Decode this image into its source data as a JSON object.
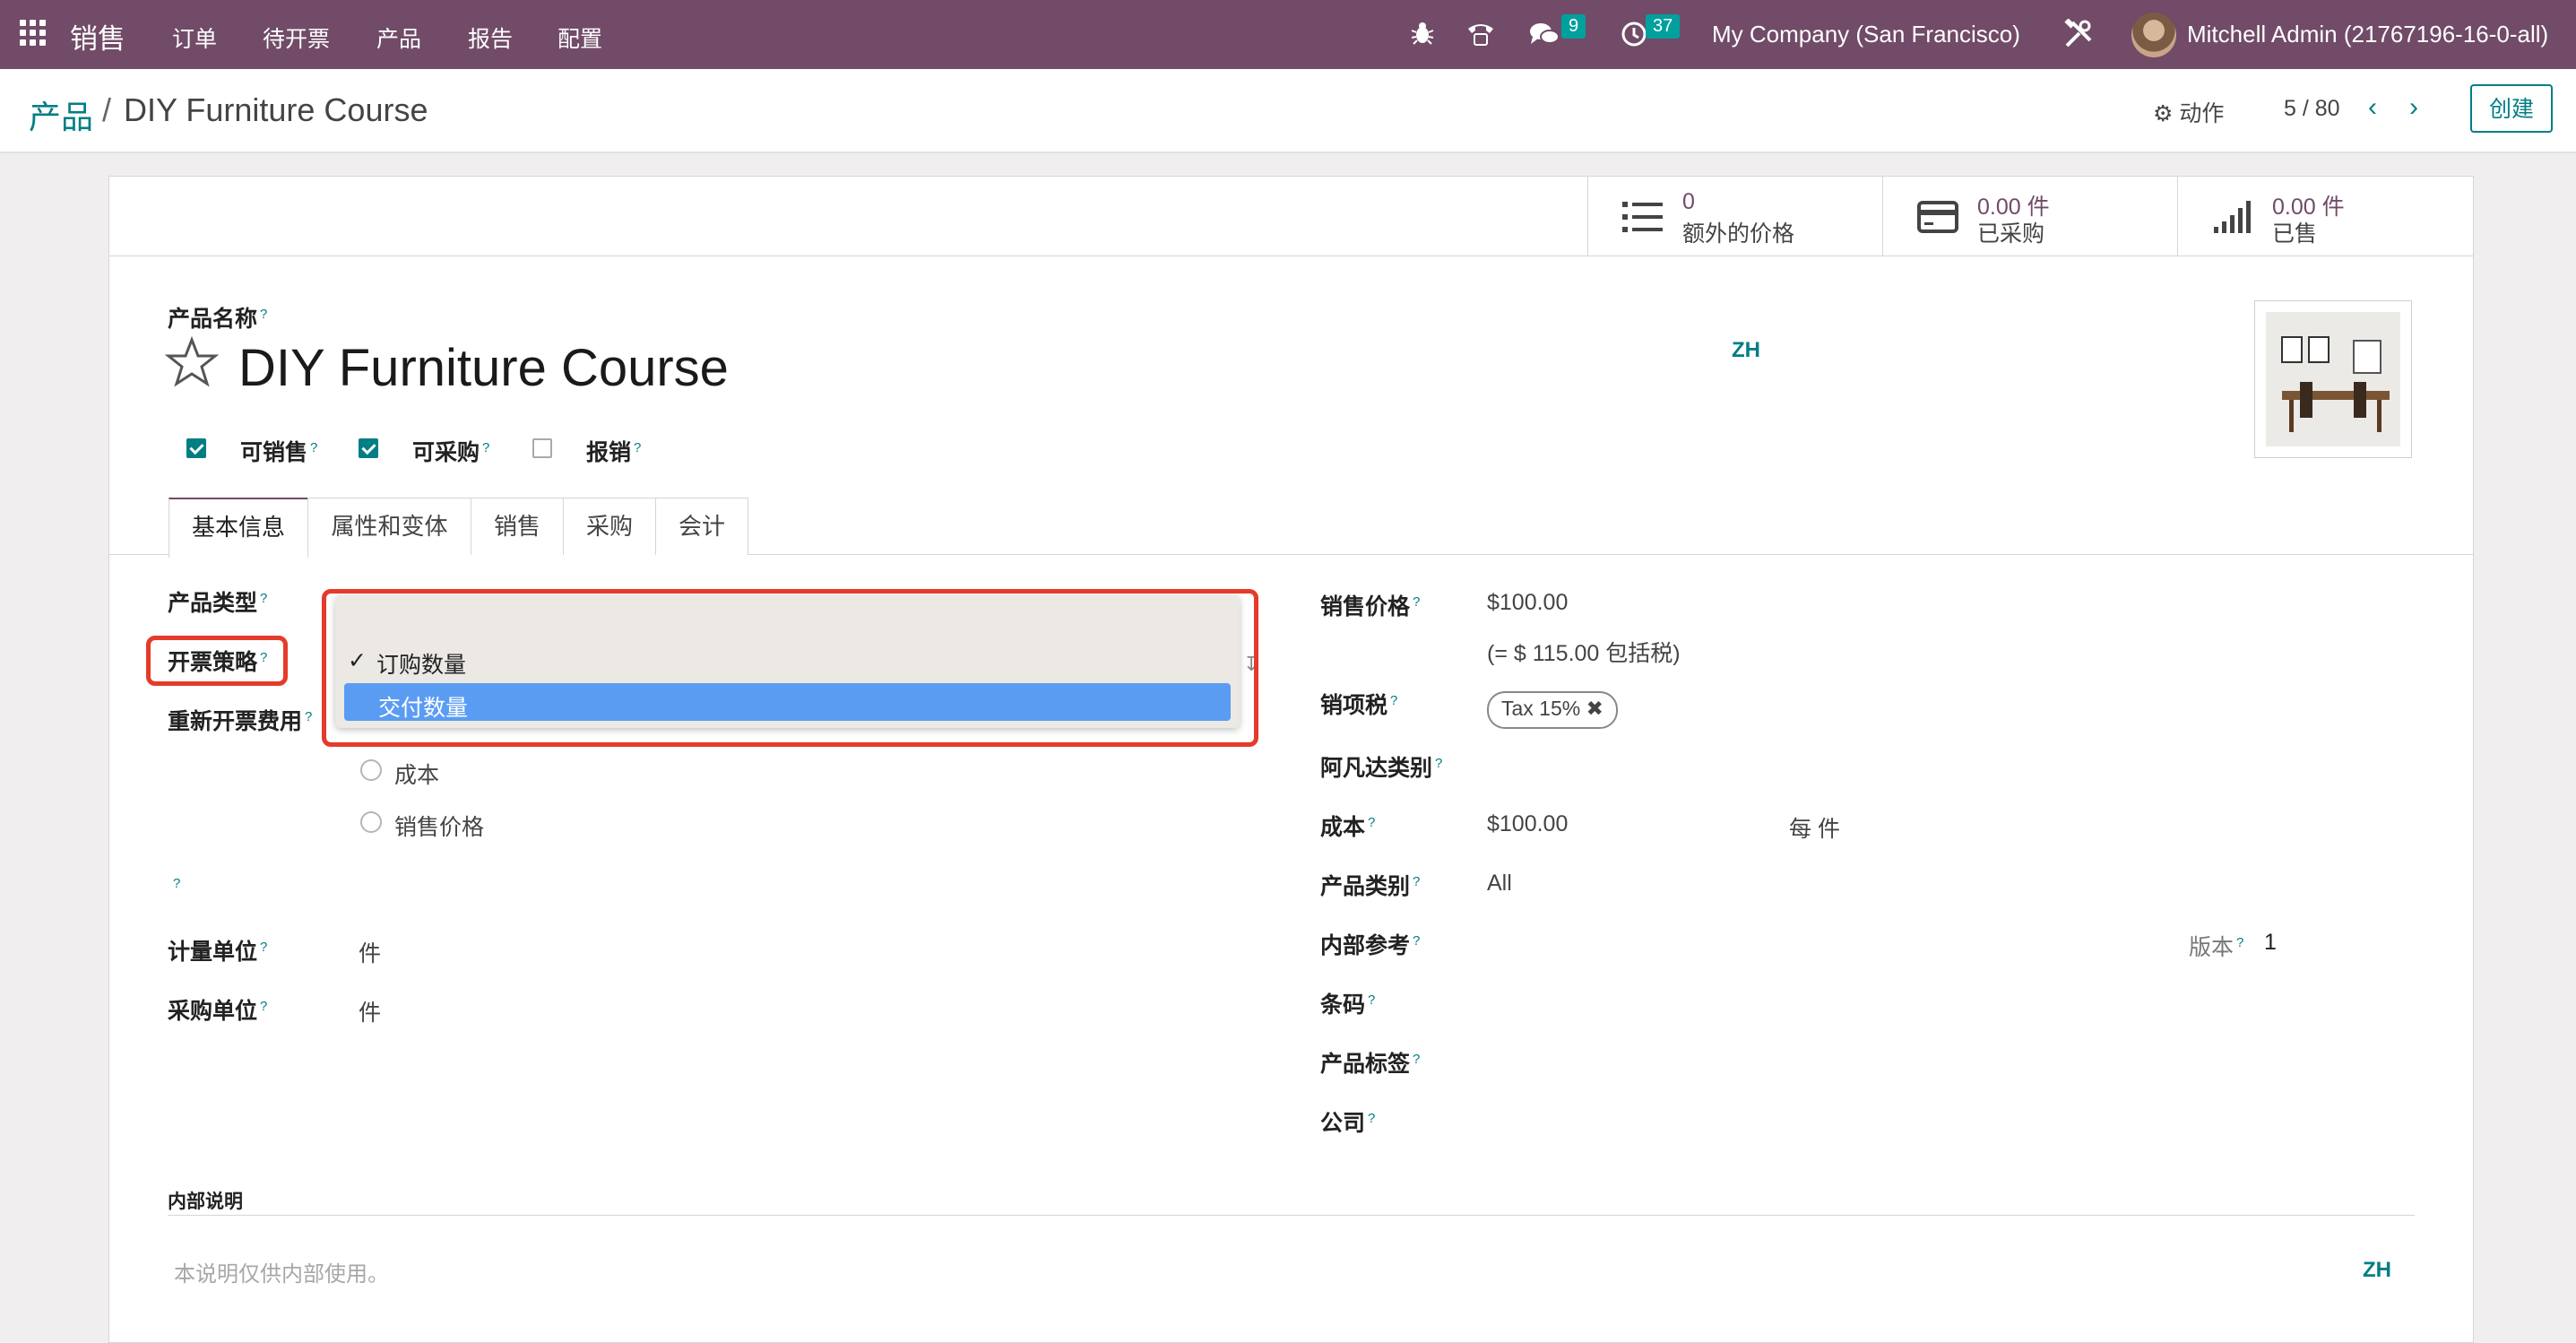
{
  "topbar": {
    "brand": "销售",
    "menu": [
      "订单",
      "待开票",
      "产品",
      "报告",
      "配置"
    ],
    "messages_count": "9",
    "activities_count": "37",
    "company": "My Company (San Francisco)",
    "user": "Mitchell Admin (21767196-16-0-all)"
  },
  "control_panel": {
    "breadcrumb_root": "产品",
    "breadcrumb_sep": "/",
    "breadcrumb_current": "DIY Furniture Course",
    "action_label": "动作",
    "pager": "5 / 80",
    "create_label": "创建"
  },
  "smart_buttons": [
    {
      "value": "0",
      "label": "额外的价格",
      "icon": "list-icon"
    },
    {
      "value": "0.00 件",
      "label": "已采购",
      "icon": "credit-card-icon"
    },
    {
      "value": "0.00 件",
      "label": "已售",
      "icon": "signal-bars-icon"
    }
  ],
  "form": {
    "name_label": "产品名称",
    "q": "?",
    "name": "DIY Furniture Course",
    "lang": "ZH",
    "checkboxes": [
      {
        "label": "可销售",
        "checked": true
      },
      {
        "label": "可采购",
        "checked": true
      },
      {
        "label": "报销",
        "checked": false
      }
    ],
    "tabs": [
      "基本信息",
      "属性和变体",
      "销售",
      "采购",
      "会计"
    ],
    "left": {
      "product_type_label": "产品类型",
      "invoice_policy_label": "开票策略",
      "reinvoice_label": "重新开票费用",
      "reinvoice_options": [
        "成本",
        "销售价格"
      ],
      "uom_label": "计量单位",
      "uom_value": "件",
      "po_uom_label": "采购单位",
      "po_uom_value": "件"
    },
    "dropdown": {
      "checked_option": "订购数量",
      "highlighted_option": "交付数量",
      "check_mark": "✓"
    },
    "right": {
      "sale_price_label": "销售价格",
      "sale_price": "$100.00",
      "sale_price_incl": "(= $ 115.00 包括税)",
      "tax_label": "销项税",
      "tax_tag": "Tax 15%",
      "avatax_label": "阿凡达类别",
      "cost_label": "成本",
      "cost_value": "$100.00",
      "cost_unit": "每 件",
      "category_label": "产品类别",
      "category_value": "All",
      "internal_ref_label": "内部参考",
      "version_label": "版本",
      "version_value": "1",
      "barcode_label": "条码",
      "tags_label": "产品标签",
      "company_label": "公司"
    },
    "internal_notes_label": "内部说明",
    "internal_notes_placeholder": "本说明仅供内部使用。"
  }
}
